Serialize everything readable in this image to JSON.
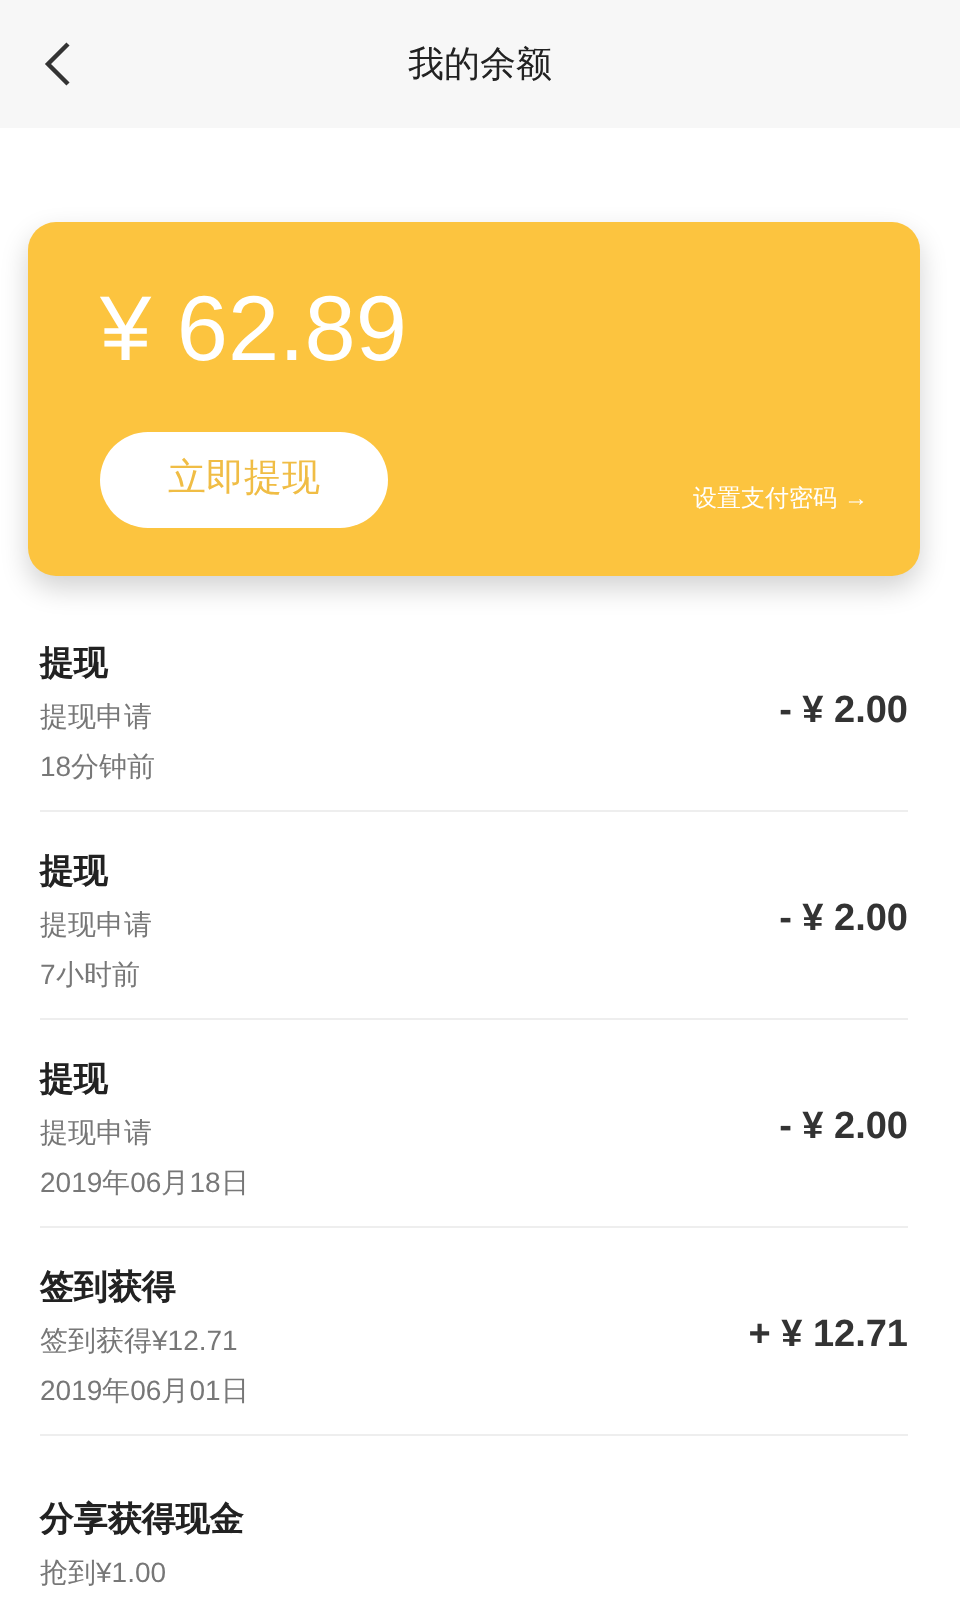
{
  "header": {
    "title": "我的余额"
  },
  "balance_card": {
    "amount": "¥ 62.89",
    "withdraw_button": "立即提现",
    "password_link": "设置支付密码 →"
  },
  "records": [
    {
      "title": "提现",
      "subtitle": "提现申请",
      "time": "18分钟前",
      "amount": "- ¥ 2.00"
    },
    {
      "title": "提现",
      "subtitle": "提现申请",
      "time": "7小时前",
      "amount": "- ¥ 2.00"
    },
    {
      "title": "提现",
      "subtitle": "提现申请",
      "time": "2019年06月18日",
      "amount": "- ¥ 2.00"
    },
    {
      "title": "签到获得",
      "subtitle": "签到获得¥12.71",
      "time": "2019年06月01日",
      "amount": "+ ¥ 12.71"
    },
    {
      "title": "分享获得现金",
      "subtitle": "抢到¥1.00"
    }
  ]
}
